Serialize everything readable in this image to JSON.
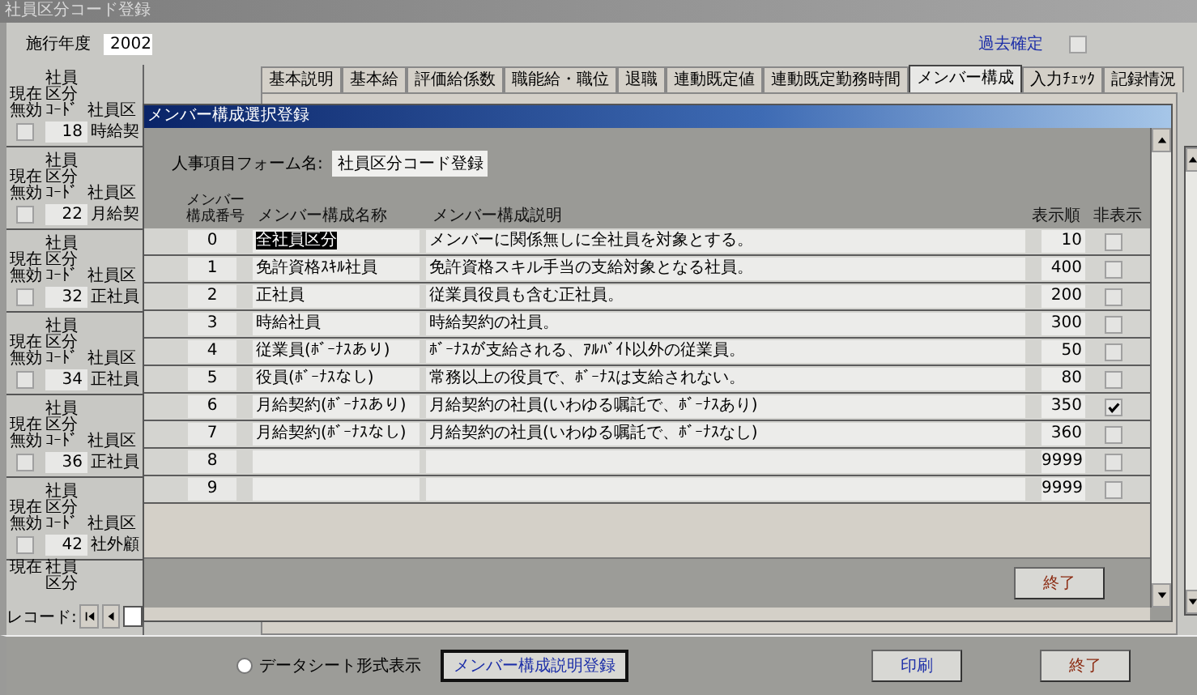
{
  "window": {
    "title": "社員区分コード登録"
  },
  "header": {
    "year_label": "施行年度",
    "year": "2002",
    "past_confirm_label": "過去確定",
    "past_confirm_checked": false
  },
  "tabs": [
    {
      "label": "基本説明",
      "selected": false
    },
    {
      "label": "基本給",
      "selected": false
    },
    {
      "label": "評価給係数",
      "selected": false
    },
    {
      "label": "職能給・職位",
      "selected": false
    },
    {
      "label": "退職",
      "selected": false
    },
    {
      "label": "連動既定値",
      "selected": false
    },
    {
      "label": "連動既定勤務時間",
      "selected": false
    },
    {
      "label": "メンバー構成",
      "selected": true
    },
    {
      "label": "入力ﾁｪｯｸ",
      "selected": false
    },
    {
      "label": "記録情況",
      "selected": false
    }
  ],
  "records": [
    {
      "invalid_label": [
        "現在",
        "無効"
      ],
      "code_label": [
        "社員",
        "区分",
        "ｺｰﾄﾞ"
      ],
      "name_label": "社員区",
      "invalid": false,
      "code": "18",
      "name": "時給契"
    },
    {
      "invalid_label": [
        "現在",
        "無効"
      ],
      "code_label": [
        "社員",
        "区分",
        "ｺｰﾄﾞ"
      ],
      "name_label": "社員区",
      "invalid": false,
      "code": "22",
      "name": "月給契"
    },
    {
      "invalid_label": [
        "現在",
        "無効"
      ],
      "code_label": [
        "社員",
        "区分",
        "ｺｰﾄﾞ"
      ],
      "name_label": "社員区",
      "invalid": false,
      "code": "32",
      "name": "正社員"
    },
    {
      "invalid_label": [
        "現在",
        "無効"
      ],
      "code_label": [
        "社員",
        "区分",
        "ｺｰﾄﾞ"
      ],
      "name_label": "社員区",
      "invalid": false,
      "code": "34",
      "name": "正社員"
    },
    {
      "invalid_label": [
        "現在",
        "無効"
      ],
      "code_label": [
        "社員",
        "区分",
        "ｺｰﾄﾞ"
      ],
      "name_label": "社員区",
      "invalid": false,
      "code": "36",
      "name": "正社員"
    },
    {
      "invalid_label": [
        "現在",
        "無効"
      ],
      "code_label": [
        "社員",
        "区分",
        "ｺｰﾄﾞ"
      ],
      "name_label": "社員区",
      "invalid": false,
      "code": "42",
      "name": "社外顧"
    },
    {
      "invalid_label": [
        "現在"
      ],
      "code_label": [
        "社員",
        "区分"
      ]
    }
  ],
  "record_nav": {
    "label": "レコード:"
  },
  "bottom": {
    "radio": {
      "label": "データシート形式表示",
      "selected": false
    },
    "buttons": [
      {
        "label": "メンバー構成説明登録",
        "kind": "focused"
      },
      {
        "label": "印刷",
        "kind": "print"
      },
      {
        "label": "終了",
        "kind": "close"
      }
    ]
  },
  "dialog": {
    "title": "メンバー構成選択登録",
    "form_label": "人事項目フォーム名:",
    "form_name": "社員区分コード登録",
    "columns": [
      [
        "メンバー",
        "構成番号"
      ],
      "メンバー構成名称",
      "メンバー構成説明",
      "表示順",
      "非表示"
    ],
    "rows": [
      {
        "number": "0",
        "name": "全社員区分",
        "description": "メンバーに関係無しに全社員を対象とする。",
        "order": "10",
        "hidden": false,
        "selected": true
      },
      {
        "number": "1",
        "name": "免許資格ｽｷﾙ社員",
        "description": "免許資格スキル手当の支給対象となる社員。",
        "order": "400",
        "hidden": false,
        "selected": false
      },
      {
        "number": "2",
        "name": "正社員",
        "description": "従業員役員も含む正社員。",
        "order": "200",
        "hidden": false,
        "selected": false
      },
      {
        "number": "3",
        "name": "時給社員",
        "description": "時給契約の社員。",
        "order": "300",
        "hidden": false,
        "selected": false
      },
      {
        "number": "4",
        "name": "従業員(ﾎﾞｰﾅｽあり)",
        "description": "ﾎﾞｰﾅｽが支給される、ｱﾙﾊﾞｲﾄ以外の従業員。",
        "order": "50",
        "hidden": false,
        "selected": false
      },
      {
        "number": "5",
        "name": "役員(ﾎﾞｰﾅｽなし)",
        "description": "常務以上の役員で、ﾎﾞｰﾅｽは支給されない。",
        "order": "80",
        "hidden": false,
        "selected": false
      },
      {
        "number": "6",
        "name": "月給契約(ﾎﾞｰﾅｽあり)",
        "description": "月給契約の社員(いわゆる嘱託で、ﾎﾞｰﾅｽあり)",
        "order": "350",
        "hidden": true,
        "selected": false
      },
      {
        "number": "7",
        "name": "月給契約(ﾎﾞｰﾅｽなし)",
        "description": "月給契約の社員(いわゆる嘱託で、ﾎﾞｰﾅｽなし)",
        "order": "360",
        "hidden": false,
        "selected": false
      },
      {
        "number": "8",
        "order": "9999",
        "hidden": false
      },
      {
        "number": "9",
        "order": "9999",
        "hidden": false
      }
    ],
    "close_button": "終了"
  }
}
